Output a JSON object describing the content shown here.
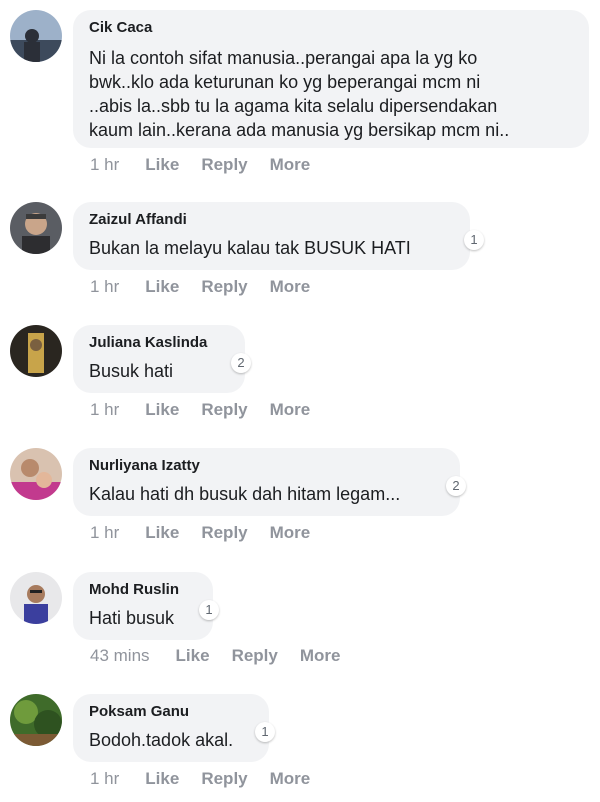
{
  "comments": [
    {
      "author": "Cik Caca",
      "text": "Ni la contoh sifat manusia..perangai apa la yg ko\nbwk..klo ada keturunan ko yg beperangai mcm ni\n..abis la..sbb tu la agama kita selalu dipersendakan\nkaum lain..kerana ada manusia yg bersikap mcm ni..",
      "reactions": "",
      "time": "1 hr",
      "like": "Like",
      "reply": "Reply",
      "more": "More"
    },
    {
      "author": "Zaizul Affandi",
      "text": "Bukan la melayu kalau tak BUSUK HATI",
      "reactions": "1",
      "time": "1 hr",
      "like": "Like",
      "reply": "Reply",
      "more": "More"
    },
    {
      "author": "Juliana Kaslinda",
      "text": "Busuk hati",
      "reactions": "2",
      "time": "1 hr",
      "like": "Like",
      "reply": "Reply",
      "more": "More"
    },
    {
      "author": "Nurliyana Izatty",
      "text": "Kalau hati dh busuk dah hitam legam...",
      "reactions": "2",
      "time": "1 hr",
      "like": "Like",
      "reply": "Reply",
      "more": "More"
    },
    {
      "author": "Mohd Ruslin",
      "text": "Hati busuk",
      "reactions": "1",
      "time": "43 mins",
      "like": "Like",
      "reply": "Reply",
      "more": "More"
    },
    {
      "author": "Poksam Ganu",
      "text": "Bodoh.tadok akal.",
      "reactions": "1",
      "time": "1 hr",
      "like": "Like",
      "reply": "Reply",
      "more": "More"
    }
  ]
}
